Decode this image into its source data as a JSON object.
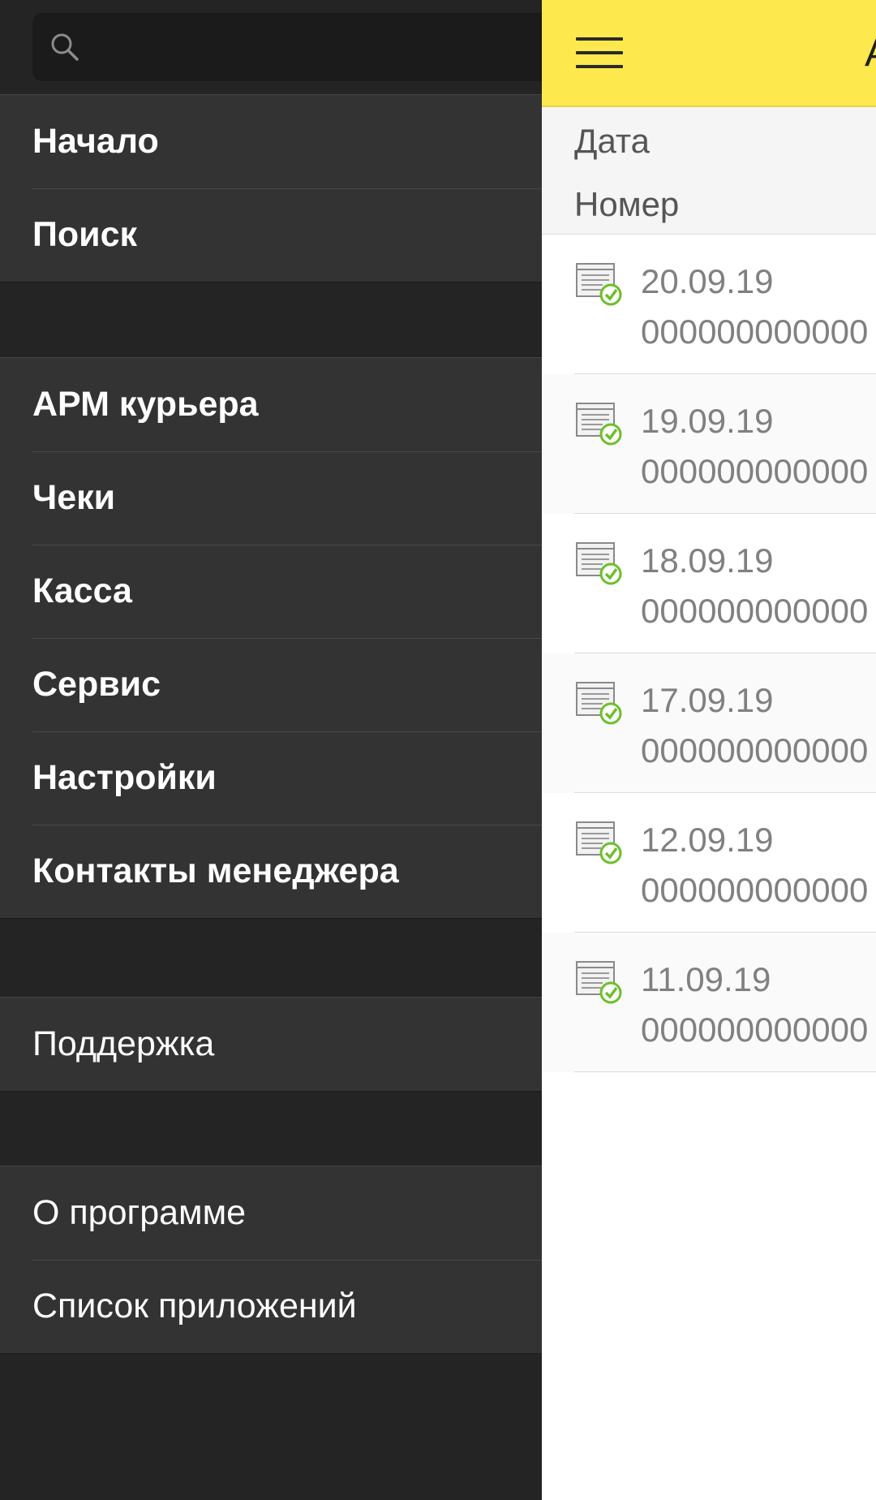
{
  "search": {
    "placeholder": "",
    "icon": "search-icon"
  },
  "toolbar": {
    "menu_icon": "hamburger-icon",
    "title_fragment": "А"
  },
  "columns": {
    "date": "Дата",
    "number": "Номер"
  },
  "menu": {
    "group_main": [
      {
        "label": "Начало"
      },
      {
        "label": "Поиск"
      }
    ],
    "group_sections": [
      {
        "label": "АРМ курьера"
      },
      {
        "label": "Чеки"
      },
      {
        "label": "Касса"
      },
      {
        "label": "Сервис"
      },
      {
        "label": "Настройки"
      },
      {
        "label": "Контакты менеджера"
      }
    ],
    "group_support": [
      {
        "label": "Поддержка"
      }
    ],
    "group_about": [
      {
        "label": "О программе"
      },
      {
        "label": "Список приложений"
      }
    ]
  },
  "documents": [
    {
      "date": "20.09.19",
      "number": "000000000000"
    },
    {
      "date": "19.09.19",
      "number": "000000000000"
    },
    {
      "date": "18.09.19",
      "number": "000000000000"
    },
    {
      "date": "17.09.19",
      "number": "000000000000"
    },
    {
      "date": "12.09.19",
      "number": "000000000000"
    },
    {
      "date": "11.09.19",
      "number": "000000000000"
    }
  ],
  "colors": {
    "appbar": "#fde94e",
    "drawer_bg": "#242424",
    "drawer_group": "#333333",
    "check_green": "#6cbf2a"
  }
}
